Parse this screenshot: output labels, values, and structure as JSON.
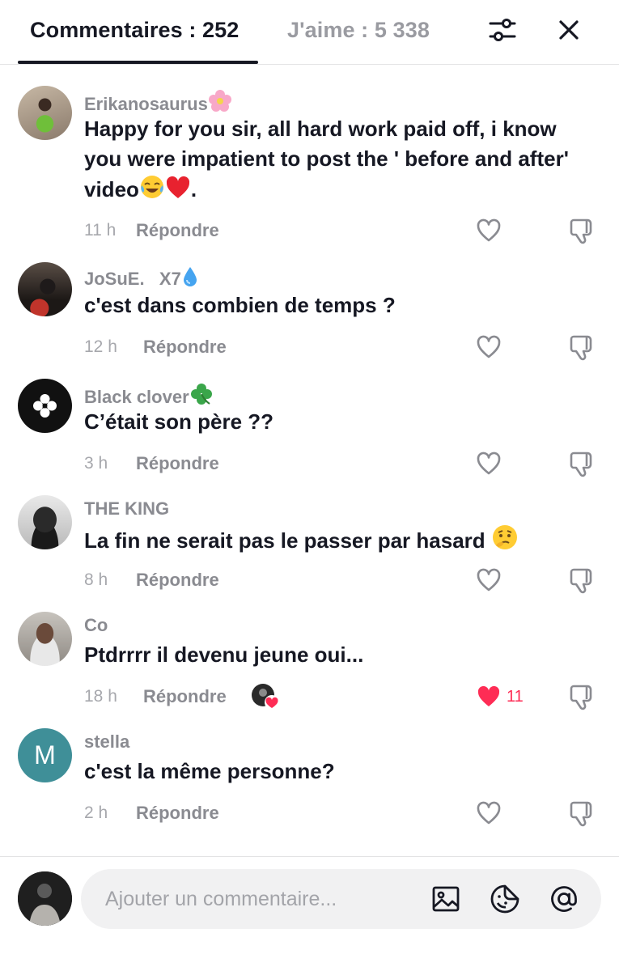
{
  "header": {
    "comments_tab": "Commentaires : 252",
    "likes_tab": "J'aime : 5 338"
  },
  "comments": [
    {
      "username": "Erikanosaurus",
      "username_emoji": "flower-emoji",
      "text": "Happy for you sir, all hard work paid off, i know you were impatient to post the ' before and after' video",
      "text_suffix": ".",
      "time": "11 h",
      "reply": "Répondre"
    },
    {
      "username": "JoSuE.   X7",
      "username_emoji": "droplet-emoji",
      "text": "c'est dans combien de temps ?",
      "time": "12 h",
      "reply": "Répondre"
    },
    {
      "username": "Black clover",
      "username_emoji": "clover-emoji",
      "text": "C’était son père ??",
      "time": "3 h",
      "reply": "Répondre"
    },
    {
      "username": "THE KING",
      "text": "La fin ne serait pas le passer par hasard",
      "time": "8 h",
      "reply": "Répondre"
    },
    {
      "username": "Co",
      "text": "Ptdrrrr il devenu jeune oui...",
      "time": "18 h",
      "reply": "Répondre",
      "likes": "11",
      "liked": true
    },
    {
      "username": "stella",
      "avatar_letter": "M",
      "text": "c'est la même personne?",
      "time": "2 h",
      "reply": "Répondre"
    }
  ],
  "composer": {
    "placeholder": "Ajouter un commentaire..."
  },
  "colors": {
    "accent_red": "#fe2c55",
    "text_primary": "#161823",
    "text_secondary": "#8a8b91",
    "avatar_teal": "#3f8f98"
  }
}
